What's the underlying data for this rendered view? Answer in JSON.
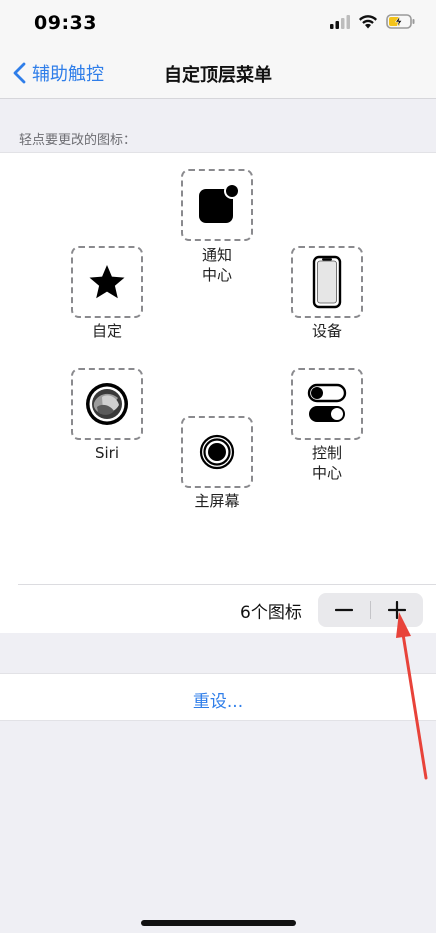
{
  "status_bar": {
    "time": "09:33"
  },
  "nav": {
    "back_label": "辅助触控",
    "title": "自定顶层菜单"
  },
  "section_label": "轻点要更改的图标：",
  "icons": [
    {
      "name": "notification-center",
      "label": "通知\n中心"
    },
    {
      "name": "custom",
      "label": "自定"
    },
    {
      "name": "device",
      "label": "设备"
    },
    {
      "name": "siri",
      "label": "Siri"
    },
    {
      "name": "control-center",
      "label": "控制\n中心"
    },
    {
      "name": "home",
      "label": "主屏幕"
    }
  ],
  "stepper": {
    "count_label": "6个图标",
    "minus": "−",
    "plus": "+"
  },
  "reset_label": "重设...",
  "colors": {
    "accent": "#2f7ee9",
    "annotation_arrow": "#e8433a"
  }
}
